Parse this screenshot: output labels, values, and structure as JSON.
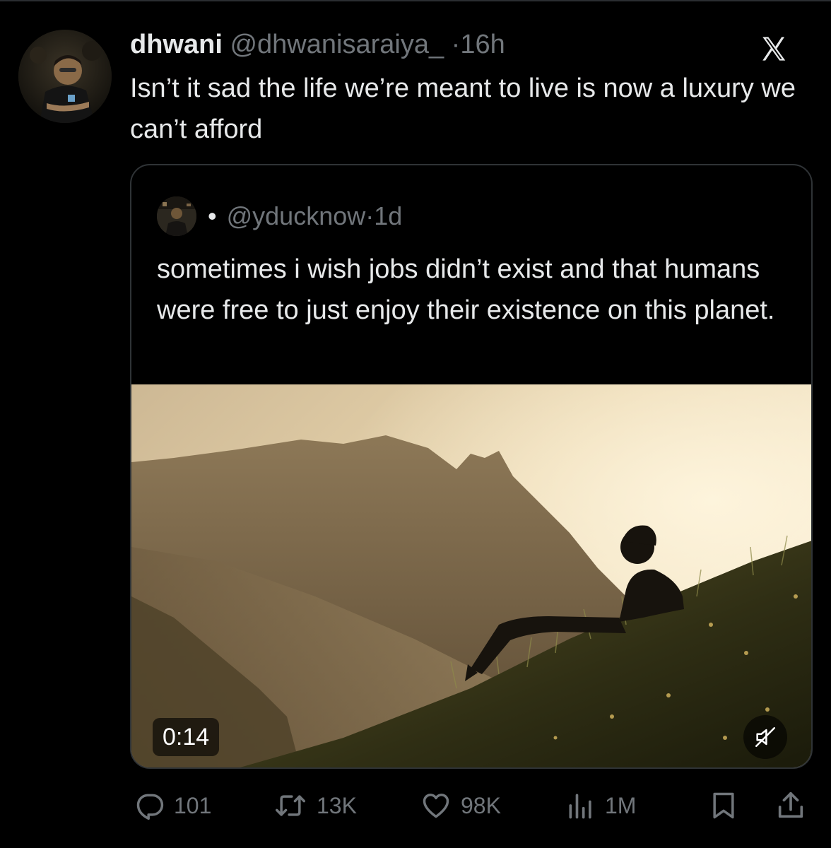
{
  "tweet": {
    "display_name": "dhwani",
    "handle": "@dhwanisaraiya_",
    "separator": "·",
    "time": "16h",
    "text": "Isn’t it sad the life we’re meant to live is now a luxury we can’t afford",
    "avatar_icon": "user-avatar-photo",
    "platform_icon": "x-logo-icon"
  },
  "quote": {
    "bullet": "•",
    "handle": "@yducknow",
    "separator": "·",
    "time": "1d",
    "text": "sometimes i wish jobs didn’t exist and that humans were free to just enjoy their existence on this planet.",
    "media": {
      "duration": "0:14",
      "mute_icon": "muted-speaker-icon"
    }
  },
  "actions": {
    "replies": "101",
    "reposts": "13K",
    "likes": "98K",
    "views": "1M",
    "bookmark_icon": "bookmark-icon",
    "share_icon": "share-icon"
  },
  "colors": {
    "background": "#000000",
    "text_primary": "#e7e9ea",
    "text_secondary": "#71767b",
    "border": "#2f3336"
  }
}
